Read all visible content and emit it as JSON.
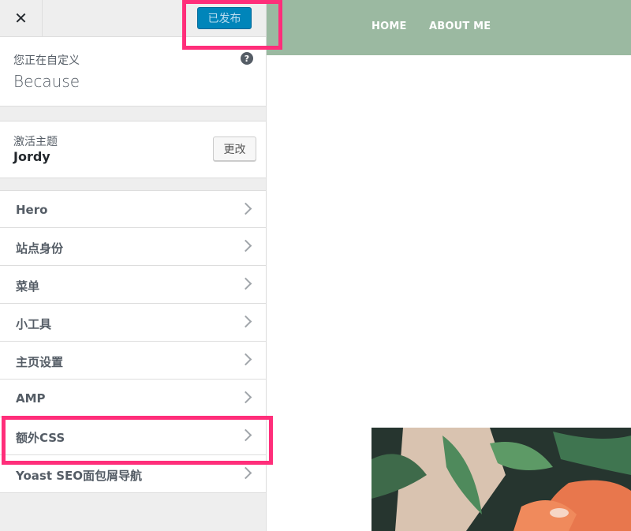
{
  "topbar": {
    "close_icon": "close-icon",
    "close_glyph": "✕",
    "publish_label": "已发布"
  },
  "info": {
    "customizing_label": "您正在自定义",
    "site_title": "Because",
    "help_glyph": "?"
  },
  "theme": {
    "label": "激活主题",
    "name": "Jordy",
    "change_label": "更改"
  },
  "sections": [
    {
      "label": "Hero"
    },
    {
      "label": "站点身份"
    },
    {
      "label": "菜单"
    },
    {
      "label": "小工具"
    },
    {
      "label": "主页设置"
    },
    {
      "label": "AMP"
    },
    {
      "label": "额外CSS"
    },
    {
      "label": "Yoast SEO面包屑导航"
    }
  ],
  "preview": {
    "nav": [
      "HOME",
      "ABOUT ME"
    ],
    "header_color": "#9bb9a1"
  },
  "colors": {
    "highlight": "#ff2e7a",
    "publish_bg": "#0085ba"
  }
}
